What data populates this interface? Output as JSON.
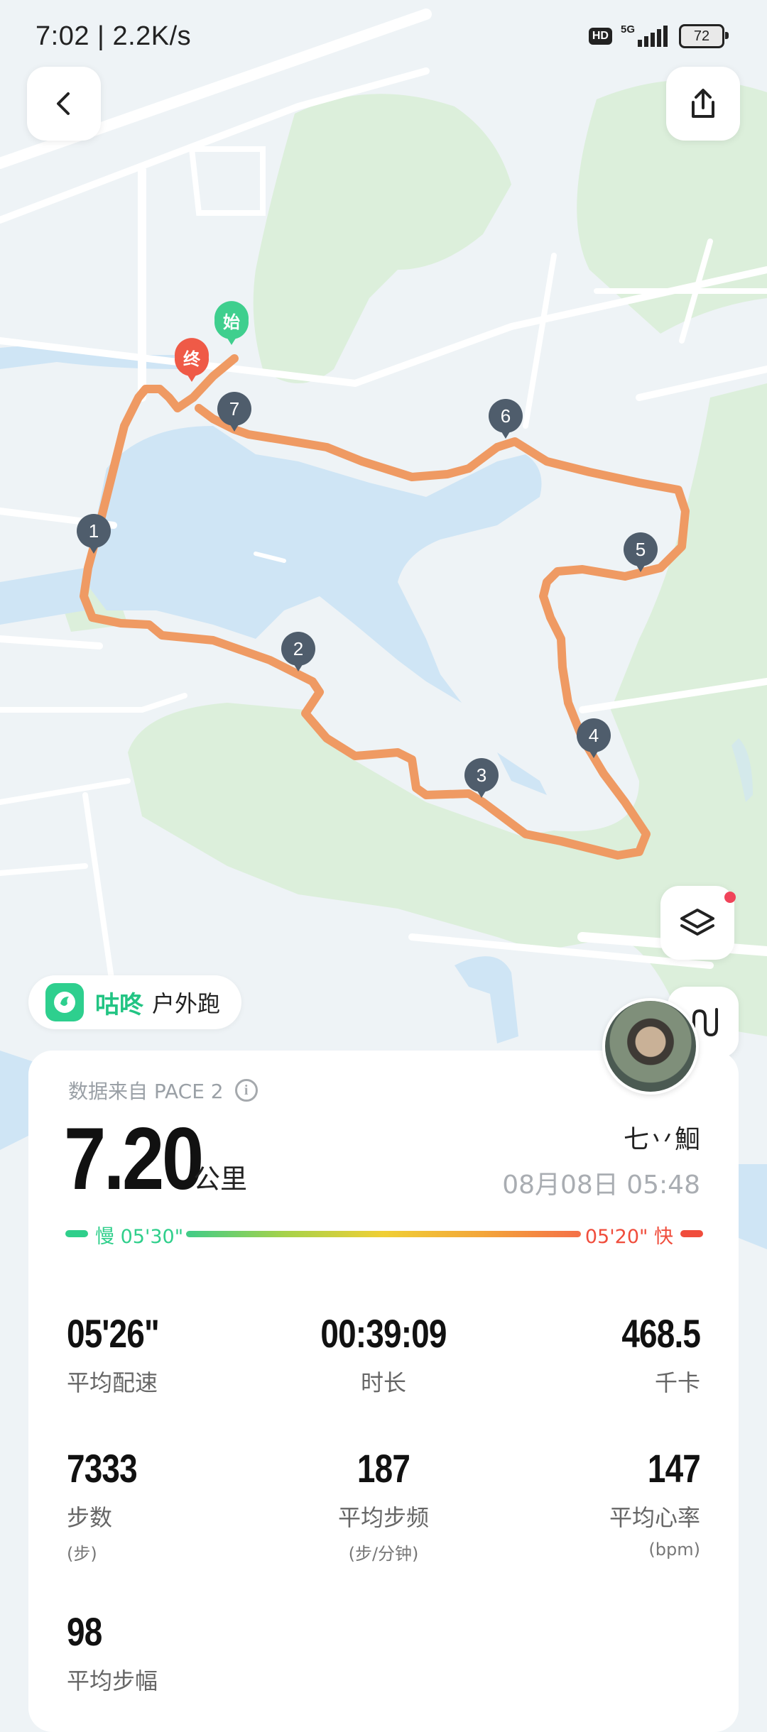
{
  "status_bar": {
    "time": "7:02 | 2.2K/s",
    "hd": "HD",
    "network": "5G",
    "battery": "72"
  },
  "map": {
    "start_label": "始",
    "end_label": "终",
    "km_markers": [
      "1",
      "2",
      "3",
      "4",
      "5",
      "6",
      "7"
    ]
  },
  "brand": {
    "name": "咕咚",
    "mode": "户外跑"
  },
  "summary": {
    "source": "数据来自 PACE 2",
    "distance": "7.20",
    "distance_unit": "公里",
    "user_name": "七丷鮰",
    "date": "08月08日 05:48",
    "pace_slow": "慢 05'30\"",
    "pace_fast": "05'20\" 快"
  },
  "metrics": [
    {
      "value": "05'26\"",
      "label": "平均配速"
    },
    {
      "value": "00:39:09",
      "label": "时长"
    },
    {
      "value": "468.5",
      "label": "千卡"
    },
    {
      "value": "7333",
      "label": "步数",
      "sub": "(步)"
    },
    {
      "value": "187",
      "label": "平均步频",
      "sub": "(步/分钟)"
    },
    {
      "value": "147",
      "label": "平均心率",
      "sub": "(bpm)"
    },
    {
      "value": "98",
      "label": "平均步幅"
    }
  ],
  "colors": {
    "route": "#ef9a63",
    "start_pin": "#3fcf8e",
    "end_pin": "#ef5a47",
    "marker_pin": "#4f5d6c",
    "brand_green": "#22c483"
  }
}
